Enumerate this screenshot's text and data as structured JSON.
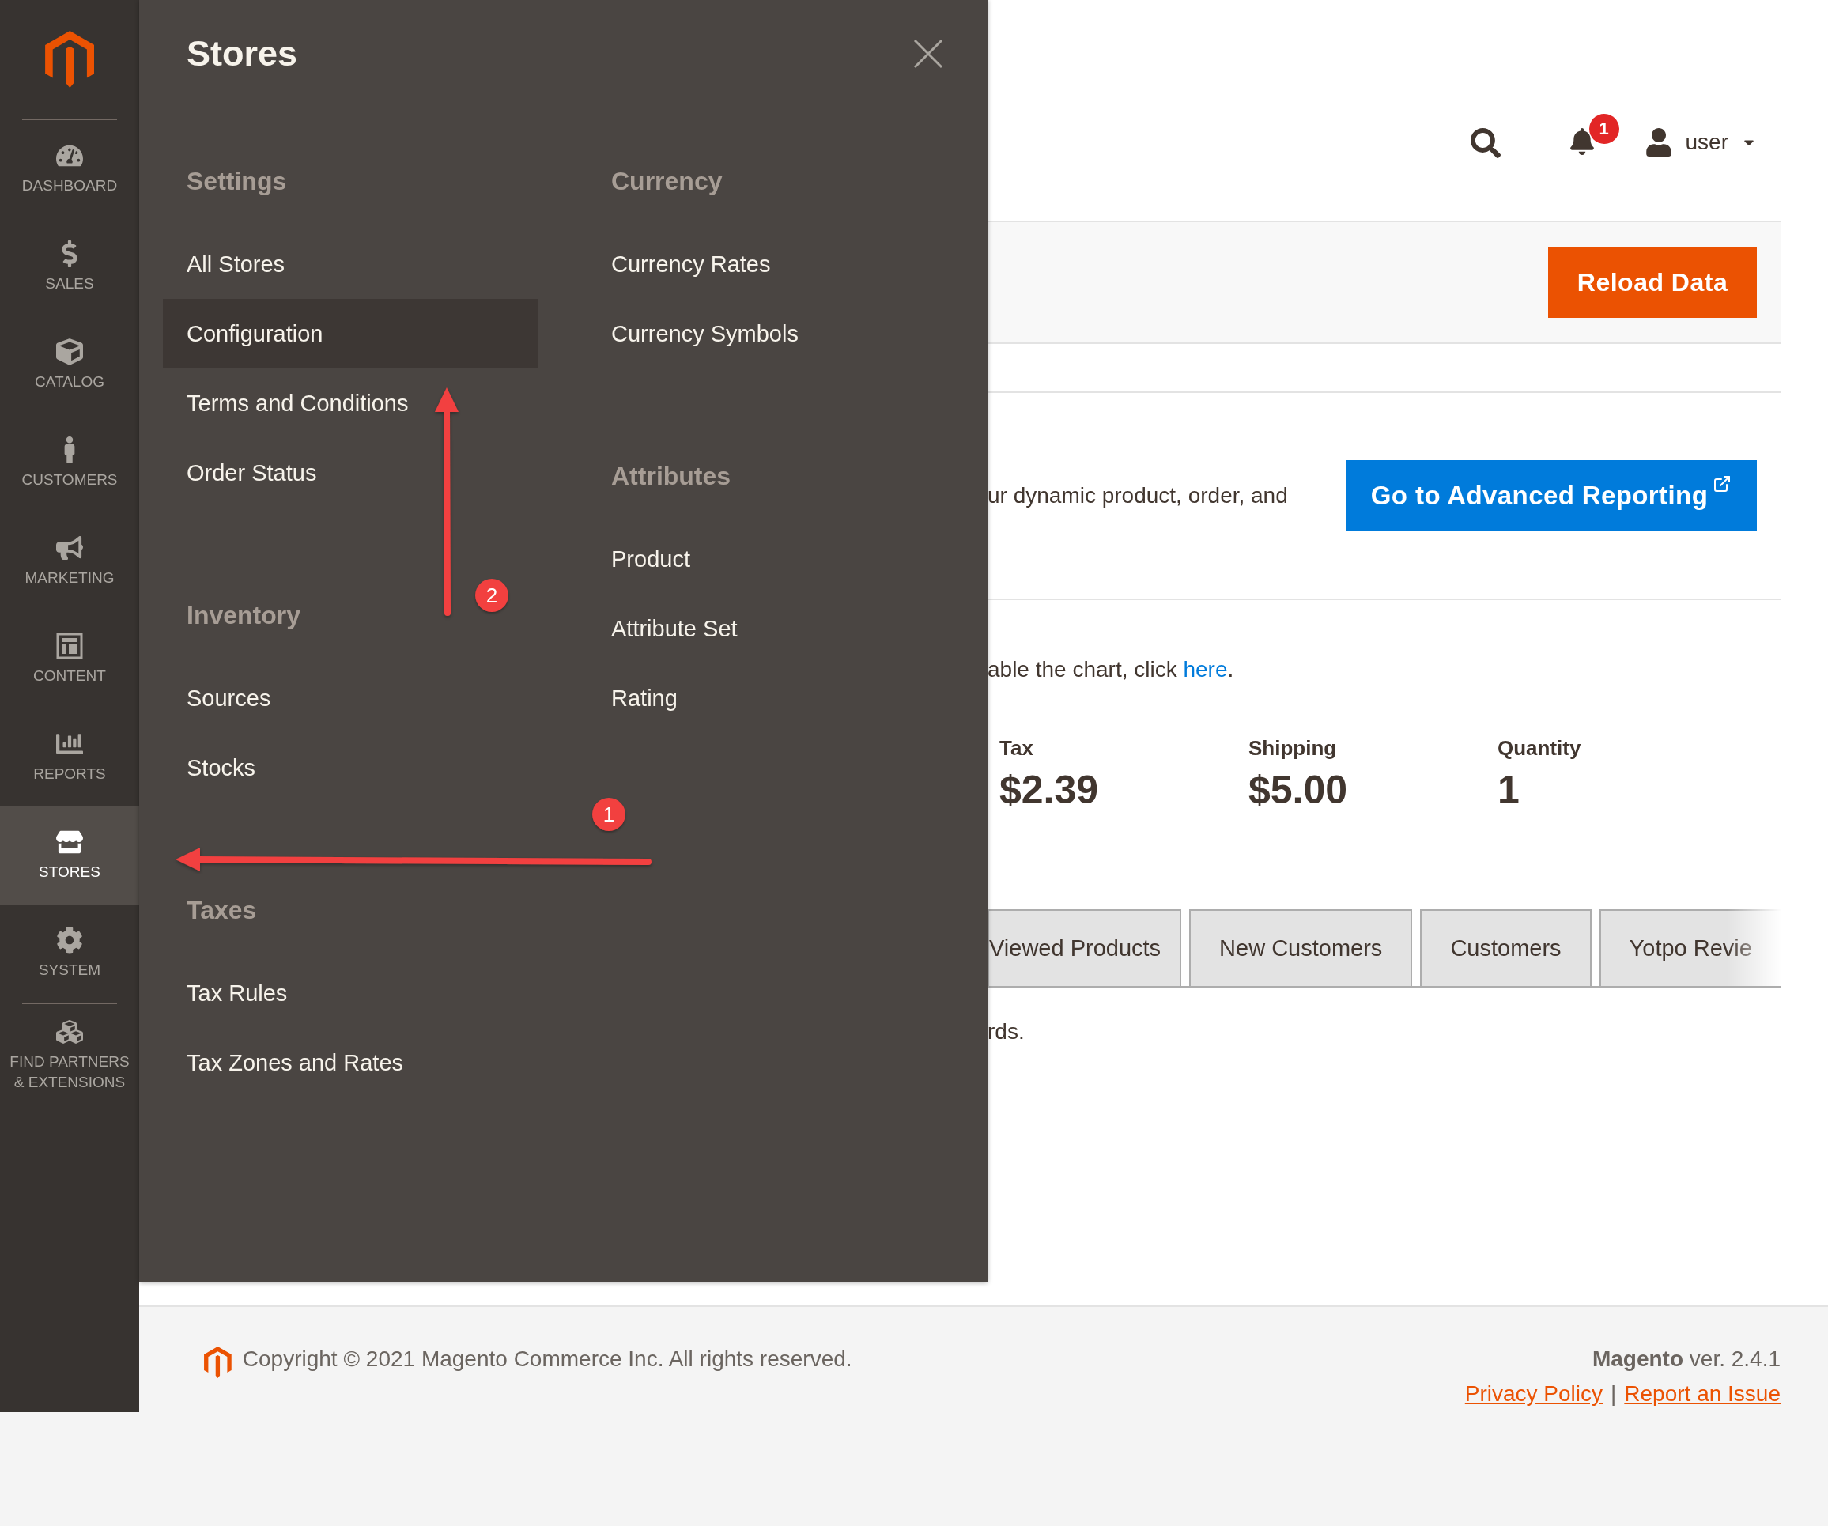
{
  "sidebar": {
    "items": [
      {
        "label": "DASHBOARD",
        "selected": false
      },
      {
        "label": "SALES",
        "selected": false
      },
      {
        "label": "CATALOG",
        "selected": false
      },
      {
        "label": "CUSTOMERS",
        "selected": false
      },
      {
        "label": "MARKETING",
        "selected": false
      },
      {
        "label": "CONTENT",
        "selected": false
      },
      {
        "label": "REPORTS",
        "selected": false
      },
      {
        "label": "STORES",
        "selected": true
      },
      {
        "label": "SYSTEM",
        "selected": false
      },
      {
        "label": "FIND PARTNERS & EXTENSIONS",
        "selected": false
      }
    ]
  },
  "menu_panel": {
    "title": "Stores",
    "columns": [
      [
        {
          "heading": "Settings",
          "items": [
            {
              "label": "All Stores",
              "selected": false
            },
            {
              "label": "Configuration",
              "selected": true
            },
            {
              "label": "Terms and Conditions",
              "selected": false
            },
            {
              "label": "Order Status",
              "selected": false
            }
          ]
        },
        {
          "heading": "Inventory",
          "items": [
            {
              "label": "Sources",
              "selected": false
            },
            {
              "label": "Stocks",
              "selected": false
            }
          ]
        },
        {
          "heading": "Taxes",
          "items": [
            {
              "label": "Tax Rules",
              "selected": false
            },
            {
              "label": "Tax Zones and Rates",
              "selected": false
            }
          ]
        }
      ],
      [
        {
          "heading": "Currency",
          "items": [
            {
              "label": "Currency Rates",
              "selected": false
            },
            {
              "label": "Currency Symbols",
              "selected": false
            }
          ]
        },
        {
          "heading": "Attributes",
          "items": [
            {
              "label": "Product",
              "selected": false
            },
            {
              "label": "Attribute Set",
              "selected": false
            },
            {
              "label": "Rating",
              "selected": false
            }
          ]
        }
      ]
    ]
  },
  "annotations": [
    {
      "number": "1"
    },
    {
      "number": "2"
    }
  ],
  "header": {
    "notification_count": "1",
    "user": "user"
  },
  "toolbar": {
    "button": "Reload Data"
  },
  "advanced_reporting": {
    "text": "ur dynamic product, order, and",
    "button": "Go to Advanced Reporting"
  },
  "chart_note": {
    "text": "able the chart, click ",
    "link": "here",
    "after": "."
  },
  "totals": [
    {
      "label": "Tax",
      "value": "$2.39"
    },
    {
      "label": "Shipping",
      "value": "$5.00"
    },
    {
      "label": "Quantity",
      "value": "1"
    }
  ],
  "tabs": [
    {
      "label": "Viewed Products",
      "selected": false
    },
    {
      "label": "New Customers",
      "selected": false
    },
    {
      "label": "Customers",
      "selected": false
    },
    {
      "label": "Yotpo Revie",
      "selected": false
    }
  ],
  "grid_note": "rds.",
  "footer": {
    "copyright": "Copyright © 2021 Magento Commerce Inc. All rights reserved.",
    "brand": "Magento",
    "version": " ver. 2.4.1",
    "links": [
      "Privacy Policy",
      "Report an Issue"
    ],
    "separator": "|"
  }
}
